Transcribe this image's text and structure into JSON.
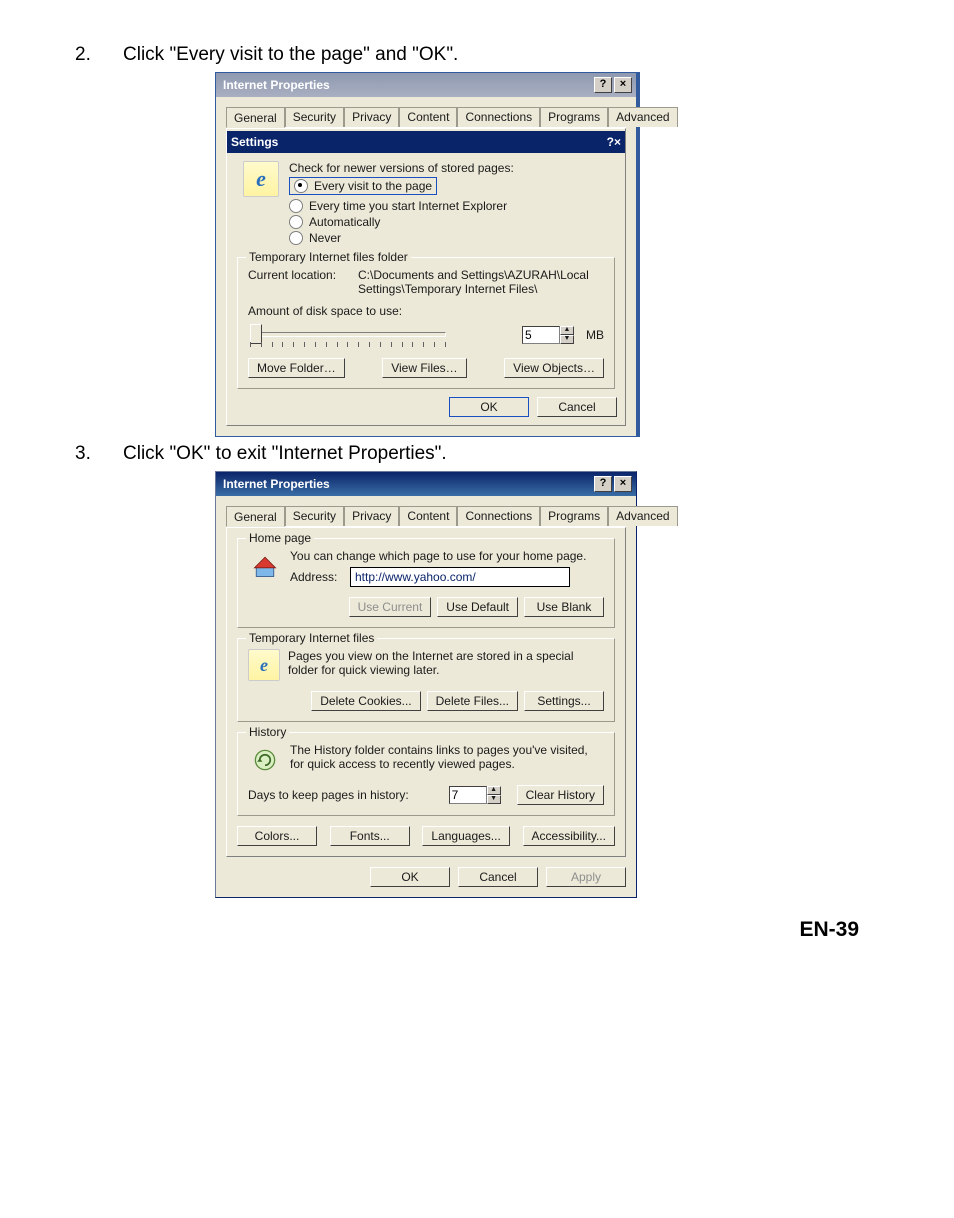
{
  "steps": {
    "s2": "Click \"Every visit to the page\" and \"OK\".",
    "s3": "Click \"OK\" to exit \"Internet Properties\"."
  },
  "tabs": {
    "general": "General",
    "security": "Security",
    "privacy": "Privacy",
    "content": "Content",
    "connections": "Connections",
    "programs": "Programs",
    "advanced": "Advanced"
  },
  "dlg1": {
    "title": "Internet Properties",
    "innerTitle": "Settings",
    "checkLabel": "Check for newer versions of stored pages:",
    "optEvery": "Every visit to the page",
    "optStart": "Every time you start Internet Explorer",
    "optAuto": "Automatically",
    "optNever": "Never",
    "tif": "Temporary Internet files folder",
    "curlocLabel": "Current location:",
    "curlocVal": "C:\\Documents and Settings\\AZURAH\\Local Settings\\Temporary Internet Files\\",
    "amount": "Amount of disk space to use:",
    "diskVal": "5",
    "mb": "MB",
    "move": "Move Folder…",
    "view": "View Files…",
    "objs": "View Objects…",
    "ok": "OK",
    "cancel": "Cancel"
  },
  "dlg2": {
    "title": "Internet Properties",
    "home": "Home page",
    "homeDesc": "You can change which page to use for your home page.",
    "addrLabel": "Address:",
    "addrVal": "http://www.yahoo.com/",
    "useCurrent": "Use Current",
    "useDefault": "Use Default",
    "useBlank": "Use Blank",
    "tif": "Temporary Internet files",
    "tifDesc": "Pages you view on the Internet are stored in a special folder for quick viewing later.",
    "delCookies": "Delete Cookies...",
    "delFiles": "Delete Files...",
    "settings": "Settings...",
    "history": "History",
    "historyDesc": "The History folder contains links to pages you've visited, for quick access to recently viewed pages.",
    "daysLabel": "Days to keep pages in history:",
    "daysVal": "7",
    "clear": "Clear History",
    "colors": "Colors...",
    "fonts": "Fonts...",
    "langs": "Languages...",
    "access": "Accessibility...",
    "ok": "OK",
    "cancel": "Cancel",
    "apply": "Apply"
  },
  "footer": "EN-39"
}
